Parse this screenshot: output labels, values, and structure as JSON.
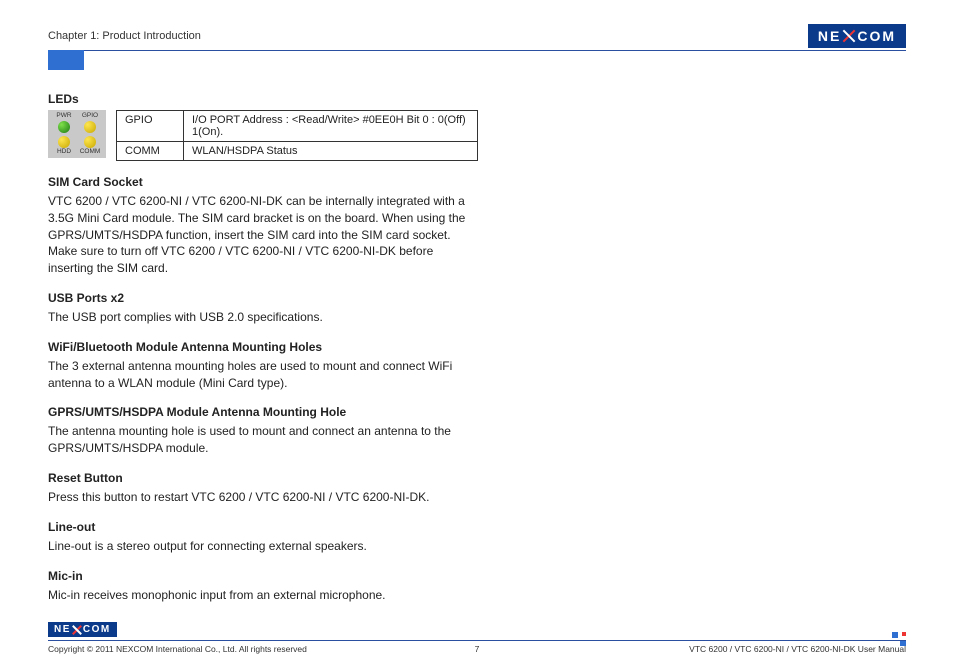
{
  "header": {
    "chapter": "Chapter 1: Product Introduction",
    "brand_left": "NE",
    "brand_right": "COM"
  },
  "leds": {
    "heading": "LEDs",
    "panel_labels": {
      "tl": "PWR",
      "tr": "GPIO",
      "bl": "HDD",
      "br": "COMM"
    },
    "rows": [
      {
        "name": "GPIO",
        "desc": "I/O PORT Address : <Read/Write>  #0EE0H Bit 0 : 0(Off) 1(On)."
      },
      {
        "name": "COMM",
        "desc": "WLAN/HSDPA Status"
      }
    ]
  },
  "sim": {
    "heading": "SIM Card Socket",
    "body": "VTC 6200 / VTC 6200-NI / VTC 6200-NI-DK can be internally integrated with a 3.5G Mini Card module. The SIM card bracket is on the board. When using the GPRS/UMTS/HSDPA function, insert the SIM card into the SIM card socket. Make sure to turn off VTC 6200 / VTC 6200-NI / VTC 6200-NI-DK before inserting the SIM card."
  },
  "usb": {
    "heading": "USB Ports x2",
    "body": "The USB port complies with USB 2.0 specifications."
  },
  "wifi": {
    "heading": "WiFi/Bluetooth Module Antenna Mounting Holes",
    "body": "The 3 external antenna mounting holes are used to mount and connect WiFi antenna to a WLAN module (Mini Card type)."
  },
  "gprs": {
    "heading": "GPRS/UMTS/HSDPA Module Antenna Mounting Hole",
    "body": "The antenna mounting hole is used to mount and connect an antenna to the GPRS/UMTS/HSDPA module."
  },
  "reset": {
    "heading": "Reset Button",
    "body": "Press this button to restart VTC 6200 / VTC 6200-NI / VTC 6200-NI-DK."
  },
  "lineout": {
    "heading": "Line-out",
    "body": "Line-out is a stereo output for connecting external speakers."
  },
  "micin": {
    "heading": "Mic-in",
    "body": "Mic-in receives monophonic input from an external microphone."
  },
  "footer": {
    "copyright": "Copyright © 2011 NEXCOM International Co., Ltd. All rights reserved",
    "page": "7",
    "doc": "VTC 6200 / VTC 6200-NI / VTC 6200-NI-DK User Manual"
  }
}
